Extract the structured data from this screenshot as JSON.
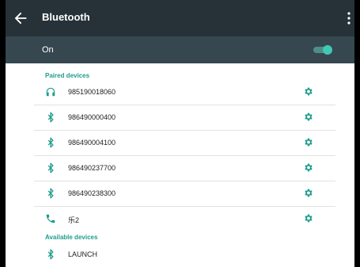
{
  "header": {
    "title": "Bluetooth"
  },
  "switch": {
    "label": "On",
    "enabled": true
  },
  "paired": {
    "heading": "Paired devices",
    "devices": [
      {
        "name": "985190018060",
        "icon": "headphones-icon"
      },
      {
        "name": "986490000400",
        "icon": "bluetooth-icon"
      },
      {
        "name": "986490004100",
        "icon": "bluetooth-icon"
      },
      {
        "name": "986490237700",
        "icon": "bluetooth-icon"
      },
      {
        "name": "986490238300",
        "icon": "bluetooth-icon"
      },
      {
        "name": "乐2",
        "icon": "phone-icon"
      }
    ]
  },
  "available": {
    "heading": "Available devices",
    "devices": [
      {
        "name": "LAUNCH",
        "icon": "bluetooth-icon"
      }
    ]
  },
  "colors": {
    "accent": "#1e9c8c",
    "appbar": "#263238",
    "switchbar": "#37474f"
  }
}
